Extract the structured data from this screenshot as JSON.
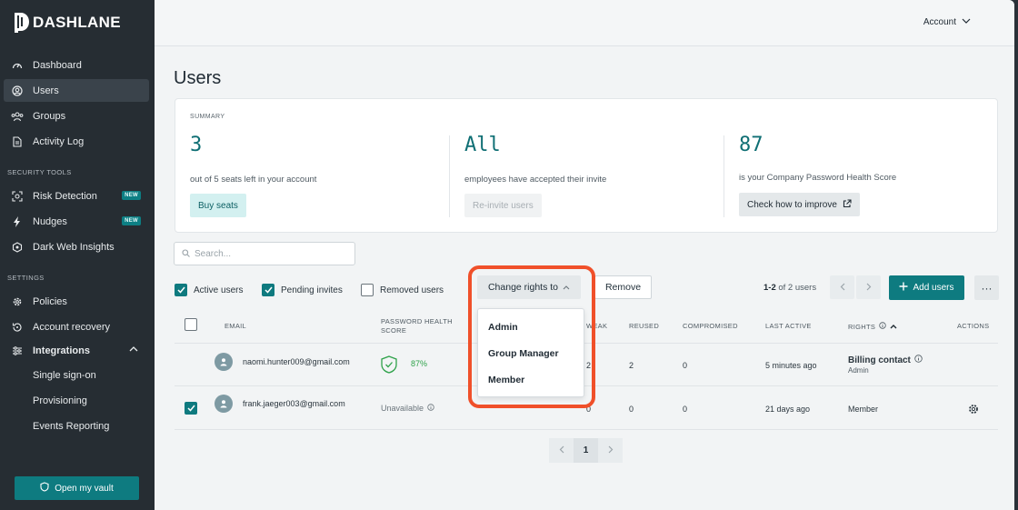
{
  "sidebar": {
    "logo_text": "DASHLANE",
    "nav": [
      {
        "label": "Dashboard",
        "icon": "gauge-icon"
      },
      {
        "label": "Users",
        "icon": "user-circle-icon",
        "active": true
      },
      {
        "label": "Groups",
        "icon": "group-icon"
      },
      {
        "label": "Activity Log",
        "icon": "document-icon"
      }
    ],
    "security_section": "SECURITY TOOLS",
    "security": [
      {
        "label": "Risk Detection",
        "badge": "NEW"
      },
      {
        "label": "Nudges",
        "badge": "NEW"
      },
      {
        "label": "Dark Web Insights",
        "badge": ""
      }
    ],
    "settings_section": "SETTINGS",
    "settings": [
      {
        "label": "Policies"
      },
      {
        "label": "Account recovery"
      },
      {
        "label": "Integrations"
      }
    ],
    "integrations_sub": [
      "Single sign-on",
      "Provisioning",
      "Events Reporting"
    ],
    "open_vault": "Open my vault"
  },
  "header": {
    "account": "Account"
  },
  "page": {
    "title": "Users"
  },
  "summary": {
    "label": "SUMMARY",
    "seats_value": "3",
    "seats_desc": "out of 5 seats left in your account",
    "seats_btn": "Buy seats",
    "invite_value": "All",
    "invite_desc": "employees have accepted their invite",
    "invite_btn": "Re-invite users",
    "health_value": "87",
    "health_desc": "is your Company Password Health Score",
    "health_btn": "Check how to improve"
  },
  "search": {
    "placeholder": "Search..."
  },
  "filters": {
    "active": "Active users",
    "pending": "Pending invites",
    "removed": "Removed users"
  },
  "toolbar": {
    "change_rights": "Change rights to",
    "remove": "Remove",
    "range": "1-2",
    "of_users": "of 2 users",
    "add_users": "Add users",
    "more": "···"
  },
  "dropdown": {
    "options": [
      "Admin",
      "Group Manager",
      "Member"
    ]
  },
  "table": {
    "headers": {
      "email": "EMAIL",
      "health_1": "PASSWORD HEALTH",
      "health_2": "SCORE",
      "weak": "WEAK",
      "reused": "REUSED",
      "compromised": "COMPROMISED",
      "last_active": "LAST ACTIVE",
      "rights": "RIGHTS",
      "actions": "ACTIONS"
    },
    "rows": [
      {
        "email": "naomi.hunter009@gmail.com",
        "score": "87%",
        "weak": "2",
        "reused": "2",
        "compromised": "0",
        "last_active": "5 minutes ago",
        "rights": "Billing contact",
        "rights_sub": "Admin"
      },
      {
        "email": "frank.jaeger003@gmail.com",
        "score": "Unavailable",
        "weak": "0",
        "reused": "0",
        "compromised": "0",
        "last_active": "21 days ago",
        "rights": "Member"
      }
    ]
  },
  "pagination": {
    "current": "1"
  }
}
